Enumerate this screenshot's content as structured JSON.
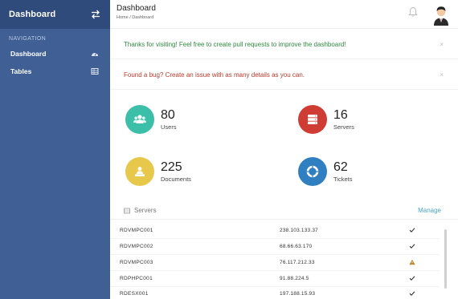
{
  "sidebar": {
    "brand": "Dashboard",
    "nav_heading": "Navigation",
    "items": [
      {
        "label": "Dashboard"
      },
      {
        "label": "Tables"
      }
    ]
  },
  "header": {
    "title": "Dashboard",
    "breadcrumb": "Home / Dashboard"
  },
  "alerts": {
    "success": "Thanks for visiting! Feel free to create pull requests to improve the dashboard!",
    "danger": "Found a bug? Create an issue with as many details as you can.",
    "close": "×"
  },
  "stats": [
    {
      "value": "80",
      "label": "Users",
      "color": "#3bbfa8",
      "icon": "users-icon"
    },
    {
      "value": "16",
      "label": "Servers",
      "color": "#cf3c33",
      "icon": "servers-icon"
    },
    {
      "value": "225",
      "label": "Documents",
      "color": "#e8c84a",
      "icon": "documents-icon"
    },
    {
      "value": "62",
      "label": "Tickets",
      "color": "#2f7fc1",
      "icon": "lifebuoy-icon"
    }
  ],
  "servers": {
    "title": "Servers",
    "manage": "Manage",
    "rows": [
      {
        "name": "RDVMPC001",
        "ip": "238.103.133.37",
        "status": "ok"
      },
      {
        "name": "RDVMPC002",
        "ip": "68.66.63.170",
        "status": "ok"
      },
      {
        "name": "RDVMPC003",
        "ip": "76.117.212.33",
        "status": "warning"
      },
      {
        "name": "RDPHPC001",
        "ip": "91.88.224.5",
        "status": "ok"
      },
      {
        "name": "RDESX001",
        "ip": "197.188.15.93",
        "status": "ok"
      }
    ]
  },
  "colors": {
    "sidebar": "#3f5f95",
    "sidebar_header": "#2f4b7c",
    "success_text": "#2e8b3f",
    "danger_text": "#c0392b",
    "link": "#4aa3c7"
  }
}
